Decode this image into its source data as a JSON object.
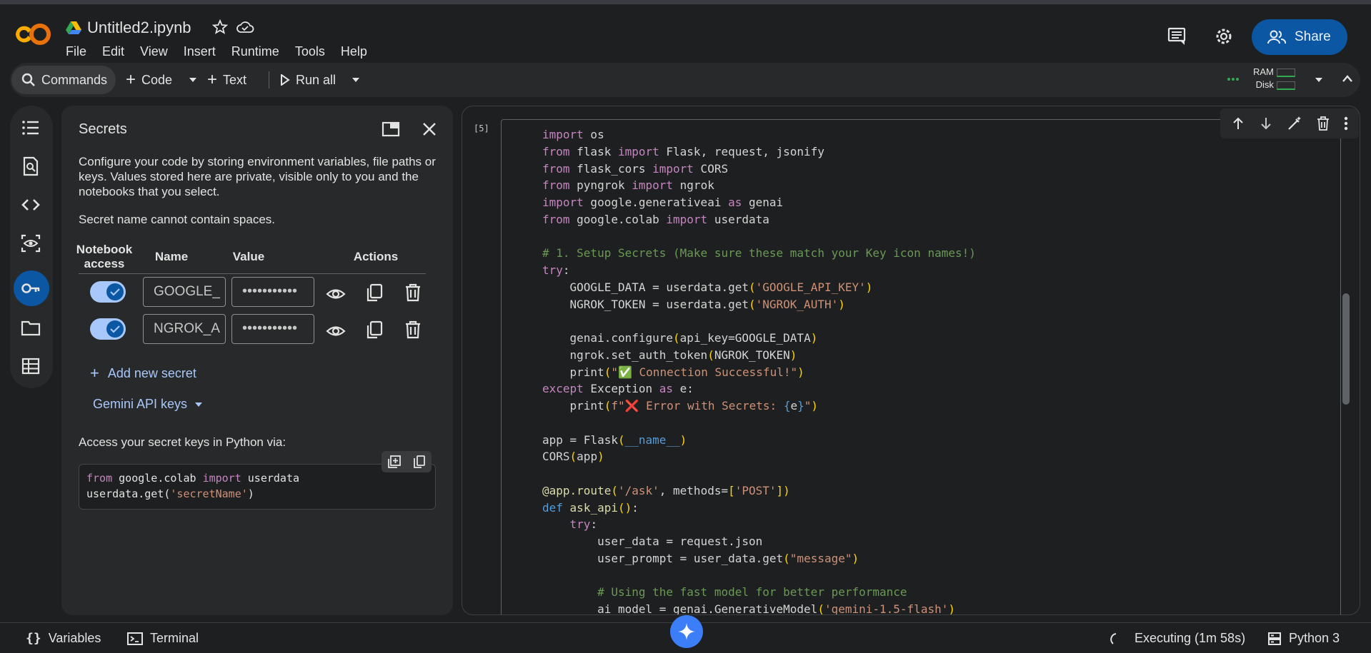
{
  "header": {
    "notebook_title": "Untitled2.ipynb",
    "menu": [
      "File",
      "Edit",
      "View",
      "Insert",
      "Runtime",
      "Tools",
      "Help"
    ],
    "share_label": "Share"
  },
  "toolbar": {
    "commands_label": "Commands",
    "code_label": "Code",
    "text_label": "Text",
    "run_all_label": "Run all",
    "ram_label": "RAM",
    "disk_label": "Disk"
  },
  "secrets_panel": {
    "title": "Secrets",
    "description": "Configure your code by storing environment variables, file paths or keys. Values stored here are private, visible only to you and the notebooks that you select.",
    "name_rule": "Secret name cannot contain spaces.",
    "columns": {
      "notebook_access": "Notebook access",
      "name": "Name",
      "value": "Value",
      "actions": "Actions"
    },
    "secrets": [
      {
        "name": "GOOGLE_",
        "value": "•••••••••••",
        "access": true
      },
      {
        "name": "NGROK_A",
        "value": "•••••••••••",
        "access": true
      }
    ],
    "add_secret_label": "Add new secret",
    "gemini_keys_label": "Gemini API keys",
    "access_note": "Access your secret keys in Python via:",
    "snippet": {
      "line1_from": "from",
      "line1_mod": " google.colab ",
      "line1_import": "import",
      "line1_name": " userdata",
      "line2_call": "userdata.get(",
      "line2_arg": "'secretName'",
      "line2_end": ")"
    }
  },
  "cell": {
    "execution_count": "[5]"
  },
  "statusbar": {
    "variables_label": "Variables",
    "terminal_label": "Terminal",
    "executing_label": "Executing (1m 58s)",
    "runtime_label": "Python 3"
  }
}
